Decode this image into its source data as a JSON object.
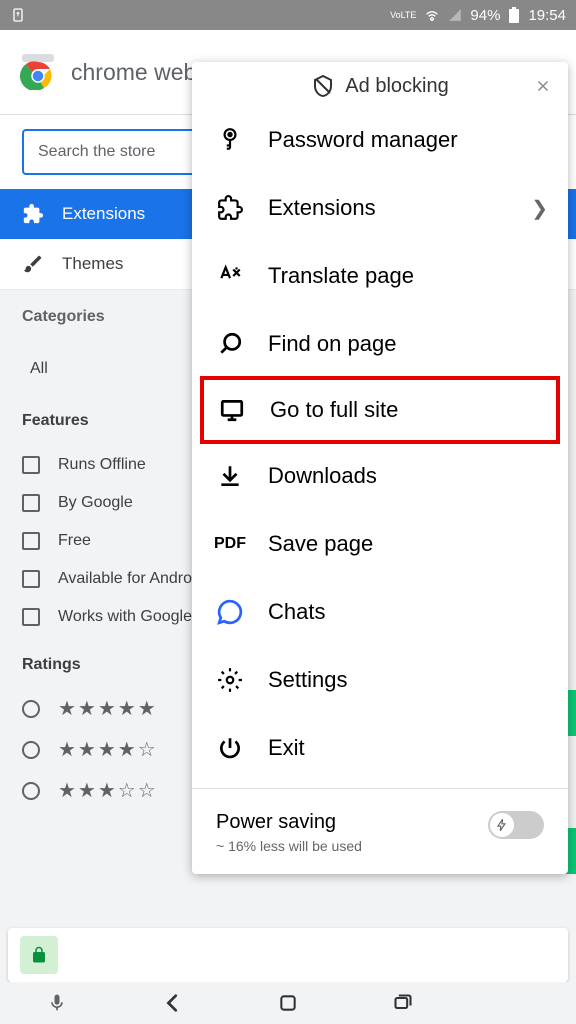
{
  "status": {
    "battery": "94%",
    "time": "19:54",
    "network": "VoLTE"
  },
  "header": {
    "title": "chrome web store"
  },
  "search": {
    "placeholder": "Search the store"
  },
  "nav": {
    "extensions": "Extensions",
    "themes": "Themes"
  },
  "categories": {
    "title": "Categories",
    "all": "All"
  },
  "features": {
    "title": "Features",
    "items": [
      "Runs Offline",
      "By Google",
      "Free",
      "Available for Android",
      "Works with Google Drive"
    ]
  },
  "ratings": {
    "title": "Ratings"
  },
  "menu": {
    "top_text": "Ad blocking",
    "items": {
      "password_manager": "Password manager",
      "extensions": "Extensions",
      "translate": "Translate page",
      "find": "Find on page",
      "full_site": "Go to full site",
      "downloads": "Downloads",
      "save_page": "Save page",
      "chats": "Chats",
      "settings": "Settings",
      "exit": "Exit"
    },
    "power_saving": {
      "title": "Power saving",
      "subtitle": "~ 16% less will be used"
    },
    "pdf_label": "PDF"
  }
}
